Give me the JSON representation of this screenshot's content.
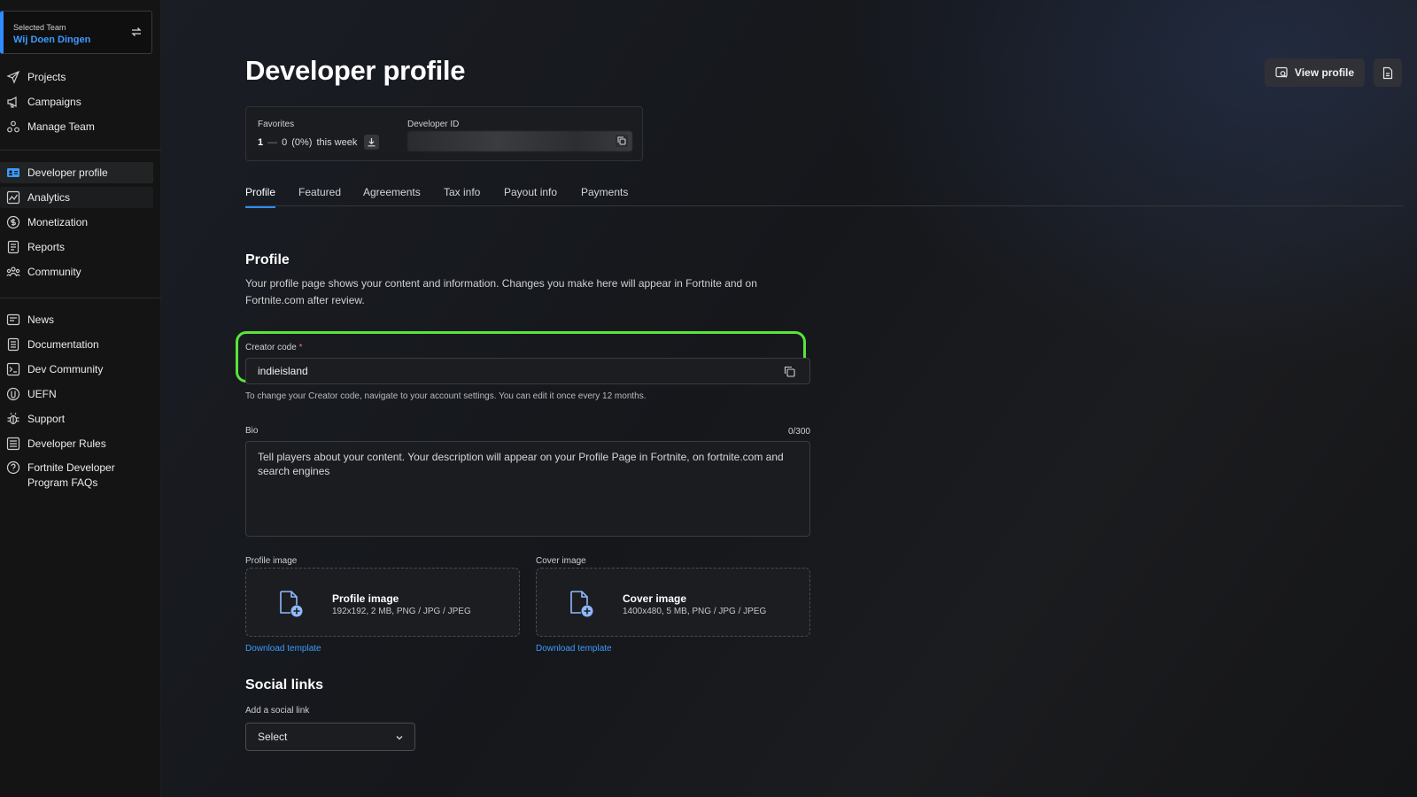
{
  "team": {
    "caption": "Selected Team",
    "name": "Wij Doen Dingen"
  },
  "sidebar": {
    "group1": [
      {
        "label": "Projects",
        "icon": "send-icon"
      },
      {
        "label": "Campaigns",
        "icon": "megaphone-icon"
      },
      {
        "label": "Manage Team",
        "icon": "team-icon"
      }
    ],
    "group2": [
      {
        "label": "Developer profile",
        "icon": "profile-card-icon"
      },
      {
        "label": "Analytics",
        "icon": "analytics-icon"
      },
      {
        "label": "Monetization",
        "icon": "dollar-icon"
      },
      {
        "label": "Reports",
        "icon": "report-icon"
      },
      {
        "label": "Community",
        "icon": "community-icon"
      }
    ],
    "group3": [
      {
        "label": "News",
        "icon": "news-icon"
      },
      {
        "label": "Documentation",
        "icon": "document-icon"
      },
      {
        "label": "Dev Community",
        "icon": "terminal-icon"
      },
      {
        "label": "UEFN",
        "icon": "unreal-icon"
      },
      {
        "label": "Support",
        "icon": "bug-icon"
      },
      {
        "label": "Developer Rules",
        "icon": "rules-icon"
      },
      {
        "label": "Fortnite Developer Program FAQs",
        "icon": "question-icon"
      }
    ]
  },
  "header": {
    "title": "Developer profile",
    "view_profile_label": "View profile"
  },
  "stats": {
    "favorites_label": "Favorites",
    "favorites_count": "1",
    "favorites_change": "0",
    "favorites_percent": "(0%)",
    "favorites_period": "this week",
    "developer_id_label": "Developer ID"
  },
  "tabs": [
    "Profile",
    "Featured",
    "Agreements",
    "Tax info",
    "Payout info",
    "Payments"
  ],
  "profile": {
    "title": "Profile",
    "description": "Your profile page shows your content and information. Changes you make here will appear in Fortnite and on Fortnite.com after review.",
    "creator_code_label": "Creator code",
    "creator_code_required": "*",
    "creator_code_value": "indieisland",
    "creator_code_hint": "To change your Creator code, navigate to your account settings. You can edit it once every 12 months.",
    "bio_label": "Bio",
    "bio_counter": "0/300",
    "bio_placeholder": "Tell players about your content. Your description will appear on your Profile Page in Fortnite, on fortnite.com and search engines",
    "profile_image_label": "Profile image",
    "profile_image_title": "Profile image",
    "profile_image_spec": "192x192, 2 MB, PNG / JPG / JPEG",
    "cover_image_label": "Cover image",
    "cover_image_title": "Cover image",
    "cover_image_spec": "1400x480, 5 MB, PNG / JPG / JPEG",
    "download_template": "Download template"
  },
  "social": {
    "title": "Social links",
    "add_label": "Add a social link",
    "select_value": "Select"
  },
  "colors": {
    "accent": "#2f8cff",
    "highlight": "#58e43a",
    "required": "#ff6a5a"
  }
}
